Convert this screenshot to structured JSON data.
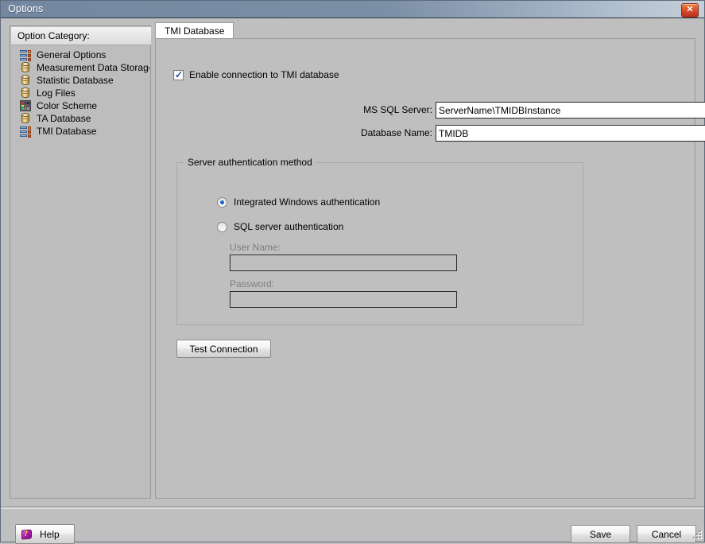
{
  "window": {
    "title": "Options",
    "close_label": "✕"
  },
  "sidebar": {
    "header": "Option Category:",
    "items": [
      {
        "label": "General Options",
        "icon": "options-list-icon"
      },
      {
        "label": "Measurement Data Storage",
        "icon": "database-icon"
      },
      {
        "label": "Statistic Database",
        "icon": "database-icon"
      },
      {
        "label": "Log Files",
        "icon": "database-icon"
      },
      {
        "label": "Color Scheme",
        "icon": "color-palette-icon"
      },
      {
        "label": "TA Database",
        "icon": "database-icon"
      },
      {
        "label": "TMI Database",
        "icon": "options-list-icon"
      }
    ]
  },
  "tabs": [
    {
      "label": "TMI Database",
      "active": true
    }
  ],
  "form": {
    "enable_checkbox": {
      "label": "Enable connection to TMI database",
      "checked": true,
      "mark": "✓"
    },
    "server_field": {
      "label": "MS SQL Server:",
      "value": "ServerName\\TMIDBInstance",
      "placeholder": ""
    },
    "database_field": {
      "label": "Database Name:",
      "value": "TMIDB",
      "placeholder": ""
    },
    "auth_group": {
      "title": "Server authentication method",
      "options": [
        {
          "label": "Integrated Windows authentication",
          "selected": true
        },
        {
          "label": "SQL server authentication",
          "selected": false
        }
      ],
      "username_field": {
        "label": "User Name:",
        "value": "",
        "placeholder": "",
        "disabled": true
      },
      "password_field": {
        "label": "Password:",
        "value": "",
        "placeholder": "",
        "disabled": true
      }
    },
    "test_connection_button": "Test Connection"
  },
  "footer": {
    "help_button": "Help",
    "save_button": "Save",
    "cancel_button": "Cancel"
  },
  "colors": {
    "titlebar_start": "#7287a0",
    "titlebar_end": "#c6cfd9",
    "dialog_bg": "#bfbfbf",
    "close_button": "#d9522c",
    "radio_accent": "#1767c0",
    "check_accent": "#1c4e8c"
  },
  "palette_icon_colors": [
    "#d12a2a",
    "#1b3fa8",
    "#2f2f2f",
    "#f2e23c",
    "#19a82f",
    "#7a3fbf",
    "#14c0c0",
    "#e07b20",
    "#9a9a9a"
  ]
}
